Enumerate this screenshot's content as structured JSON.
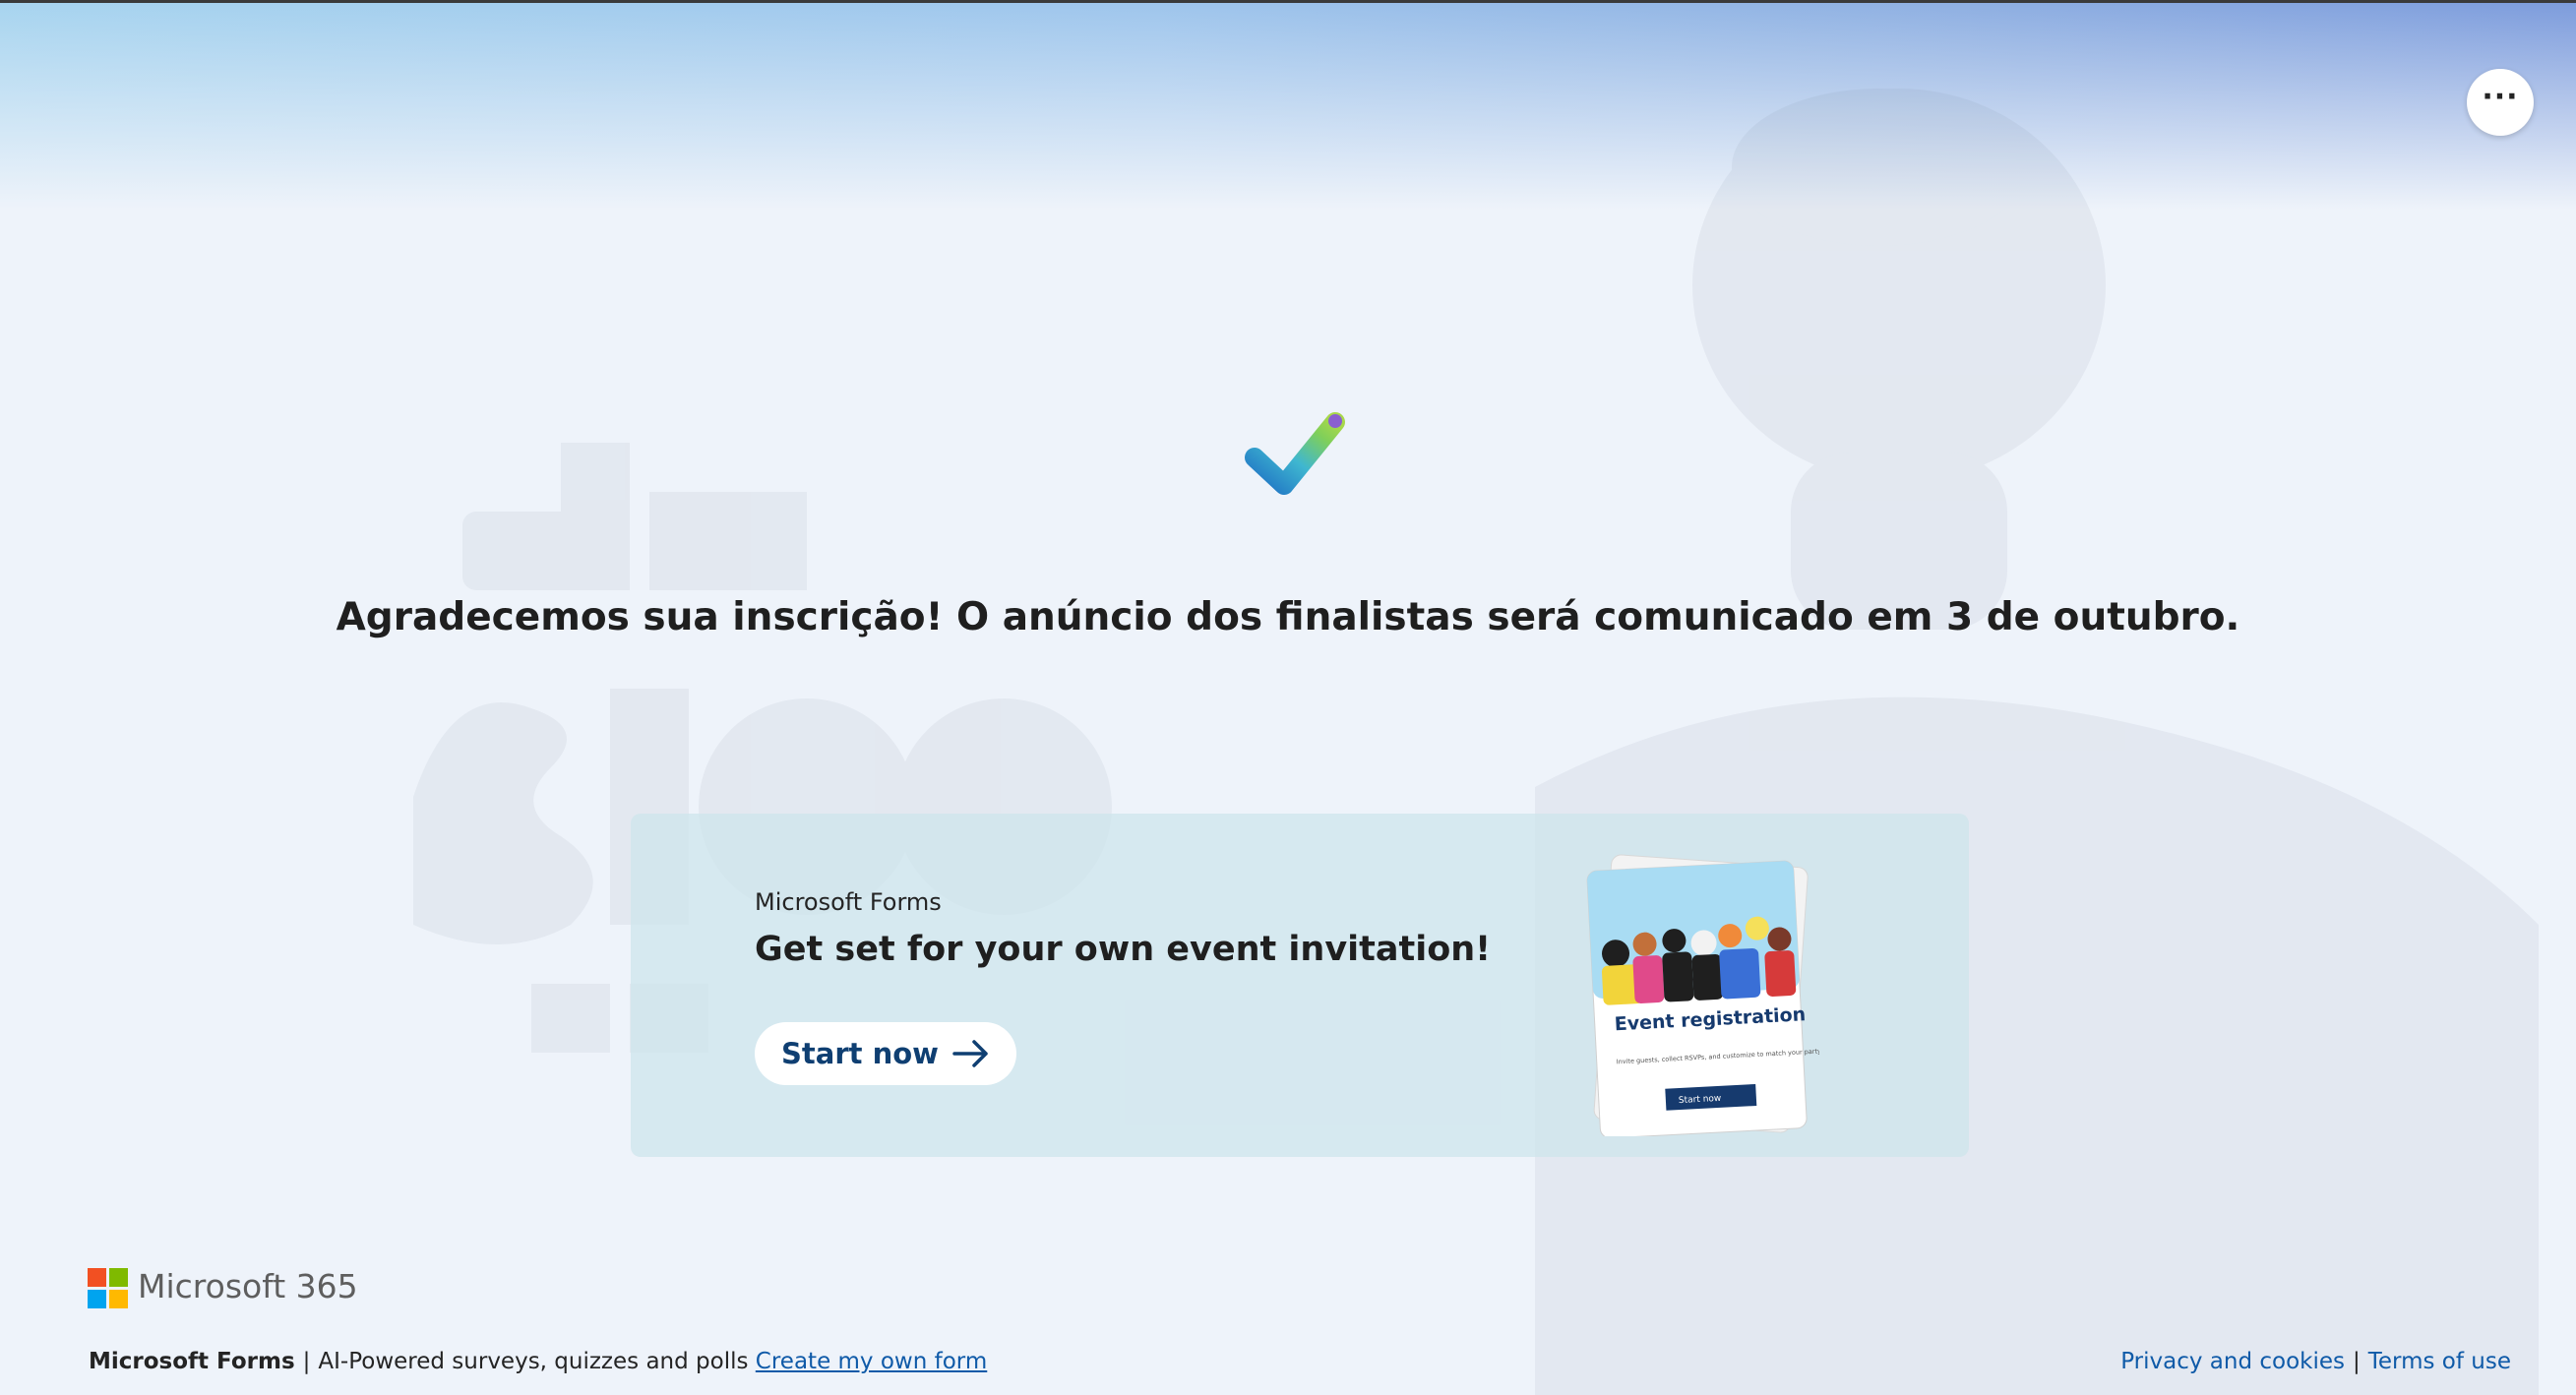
{
  "header": {
    "more_options_label": "···"
  },
  "confirmation": {
    "message": "Agradecemos sua inscrição! O anúncio dos finalistas será comunicado em 3 de outubro."
  },
  "promo": {
    "brand": "Microsoft Forms",
    "title": "Get set for your own event invitation!",
    "button_label": "Start now",
    "image": {
      "title": "Event registration",
      "description": "Invite guests, collect RSVPs, and customize to match your party theme.",
      "button": "Start now"
    }
  },
  "footer": {
    "logo_text": "Microsoft 365",
    "brand": "Microsoft Forms",
    "separator": "|",
    "tagline": "AI-Powered surveys, quizzes and polls",
    "create_link": "Create my own form",
    "privacy_link": "Privacy and cookies",
    "terms_link": "Terms of use"
  },
  "colors": {
    "accent": "#0f3f72",
    "link": "#0f5aa8",
    "card_bg": "#cde4ec"
  }
}
